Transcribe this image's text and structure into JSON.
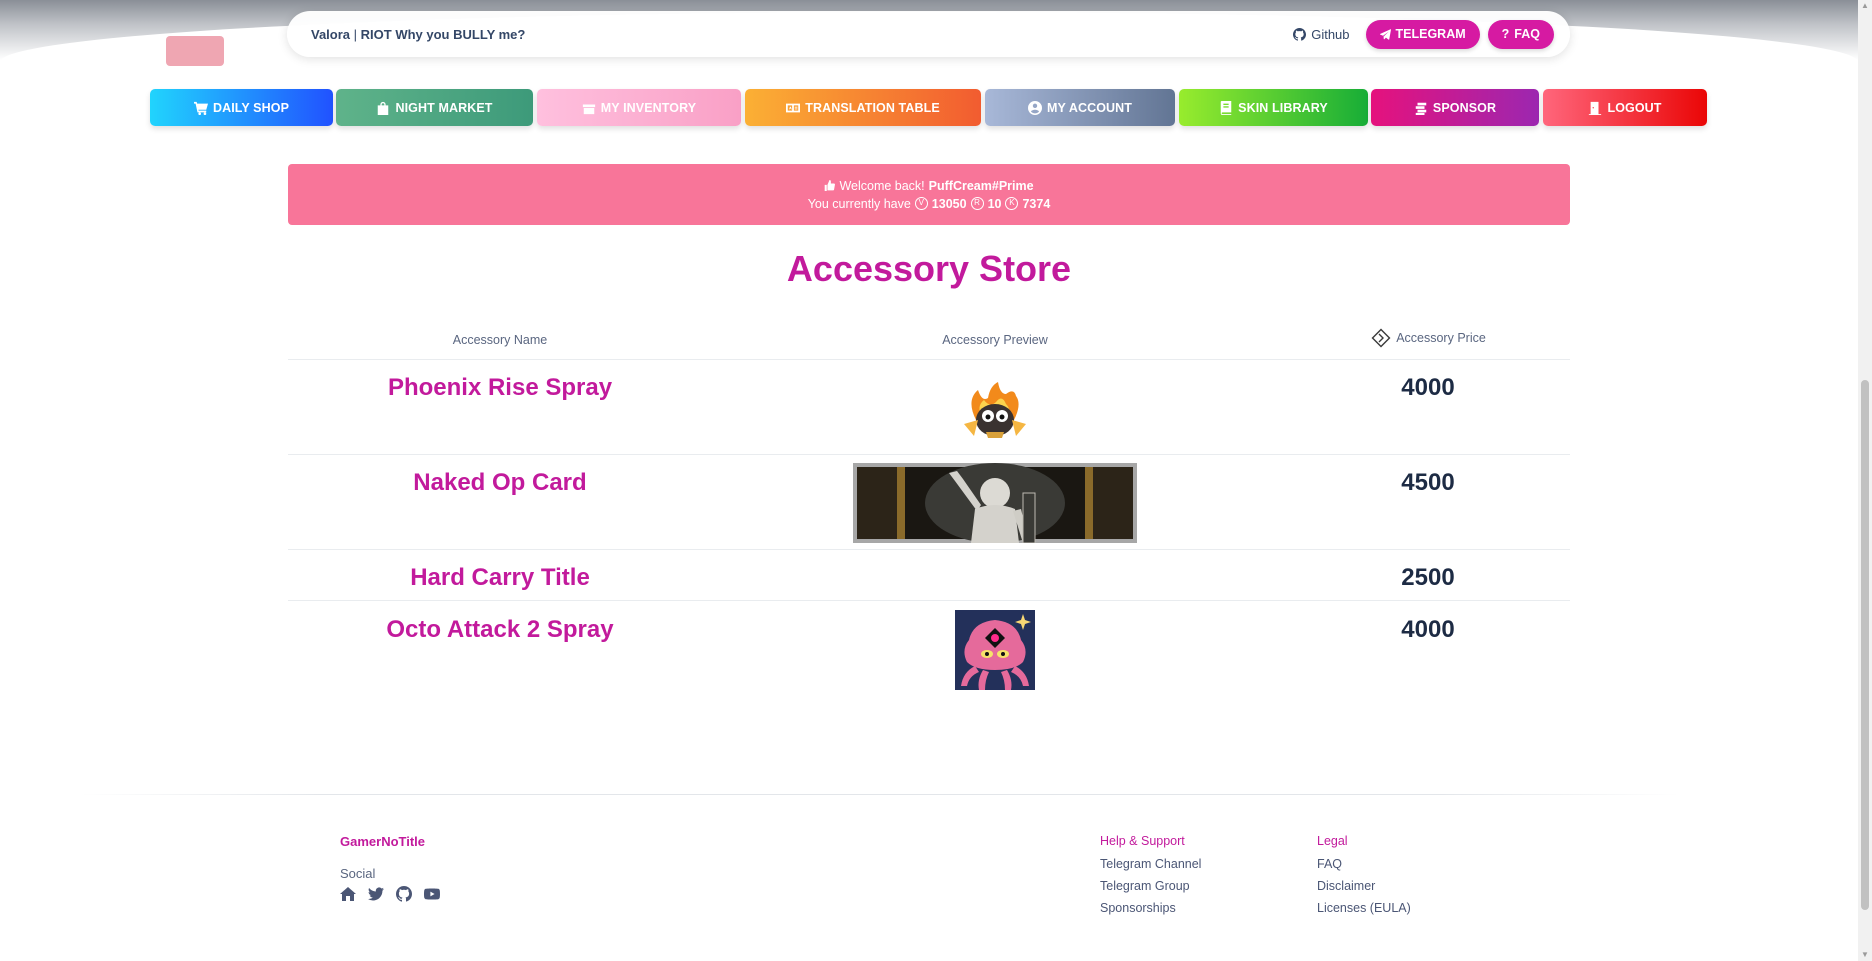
{
  "navbar": {
    "brand_main": "Valora",
    "brand_sep": "|",
    "brand_sub": "RIOT Why you BULLY me?",
    "github": "Github",
    "telegram": "TELEGRAM",
    "faq": "FAQ"
  },
  "tabs": [
    {
      "label": "DAILY SHOP",
      "icon": "cart-icon"
    },
    {
      "label": "NIGHT MARKET",
      "icon": "bag-icon"
    },
    {
      "label": "MY INVENTORY",
      "icon": "inventory-icon"
    },
    {
      "label": "TRANSLATION TABLE",
      "icon": "translate-icon"
    },
    {
      "label": "MY ACCOUNT",
      "icon": "user-icon"
    },
    {
      "label": "SKIN LIBRARY",
      "icon": "book-icon"
    },
    {
      "label": "SPONSOR",
      "icon": "coins-icon"
    },
    {
      "label": "LOGOUT",
      "icon": "door-icon"
    }
  ],
  "alert": {
    "welcome": "Welcome back!",
    "username": "PuffCream#Prime",
    "have": "You currently have",
    "vp": "13050",
    "rp": "10",
    "kc": "7374"
  },
  "title": "Accessory Store",
  "table": {
    "col_name": "Accessory Name",
    "col_preview": "Accessory Preview",
    "col_price": "Accessory Price",
    "rows": [
      {
        "name": "Phoenix Rise Spray",
        "price": "4000"
      },
      {
        "name": "Naked Op Card",
        "price": "4500"
      },
      {
        "name": "Hard Carry Title",
        "price": "2500"
      },
      {
        "name": "Octo Attack 2 Spray",
        "price": "4000"
      }
    ]
  },
  "footer": {
    "brand": "GamerNoTitle",
    "social": "Social",
    "help_heading": "Help & Support",
    "help_items": [
      "Telegram Channel",
      "Telegram Group",
      "Sponsorships"
    ],
    "legal_heading": "Legal",
    "legal_items": [
      "FAQ",
      "Disclaimer",
      "Licenses (EULA)"
    ]
  },
  "colors": {
    "accent": "#c21a9c",
    "alert": "#f87599",
    "pill": "#d61aa2"
  }
}
